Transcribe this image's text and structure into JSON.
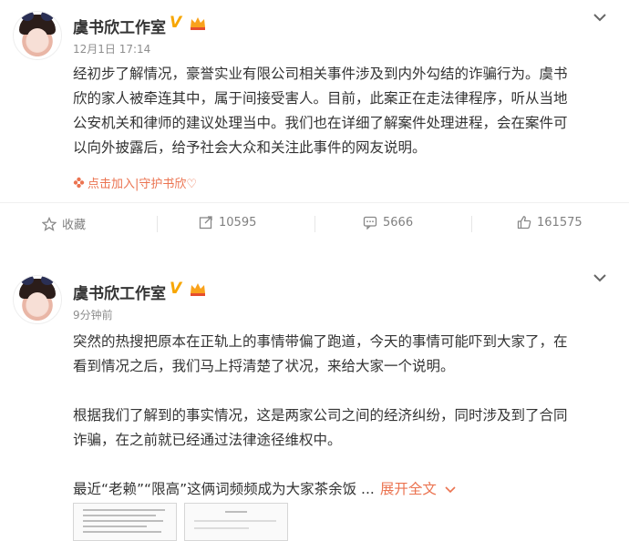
{
  "posts": [
    {
      "author": "虞书欣工作室",
      "time": "12月1日 17:14",
      "content_lines": [
        "经初步了解情况，豪誉实业有限公司相关事件涉及到内外勾结的诈骗行为。虞书",
        "欣的家人被牵连其中，属于间接受害人。目前，此案正在走法律程序，听从当地",
        "公安机关和律师的建议处理当中。我们也在详细了解案件处理进程，会在案件可",
        "以向外披露后，给予社会大众和关注此事件的网友说明。"
      ],
      "link_text": "点击加入|守护书欣♡",
      "actions": {
        "favorite": "收藏",
        "repost": "10595",
        "comment": "5666",
        "like": "161575"
      }
    },
    {
      "author": "虞书欣工作室",
      "time": "9分钟前",
      "paragraphs": [
        [
          "突然的热搜把原本在正轨上的事情带偏了跑道，今天的事情可能吓到大家了，在",
          "看到情况之后，我们马上捋清楚了状况，来给大家一个说明。"
        ],
        [
          "根据我们了解到的事实情况，这是两家公司之间的经济纠纷，同时涉及到了合同",
          "诈骗，在之前就已经通过法律途径维权中。"
        ]
      ],
      "truncated_line": "最近“老赖”“限高”这俩词频频成为大家茶余饭 ...",
      "expand_label": "展开全文"
    }
  ],
  "colors": {
    "accent": "#eb7350",
    "verified": "#f7a600",
    "muted": "#8e8e8e"
  }
}
